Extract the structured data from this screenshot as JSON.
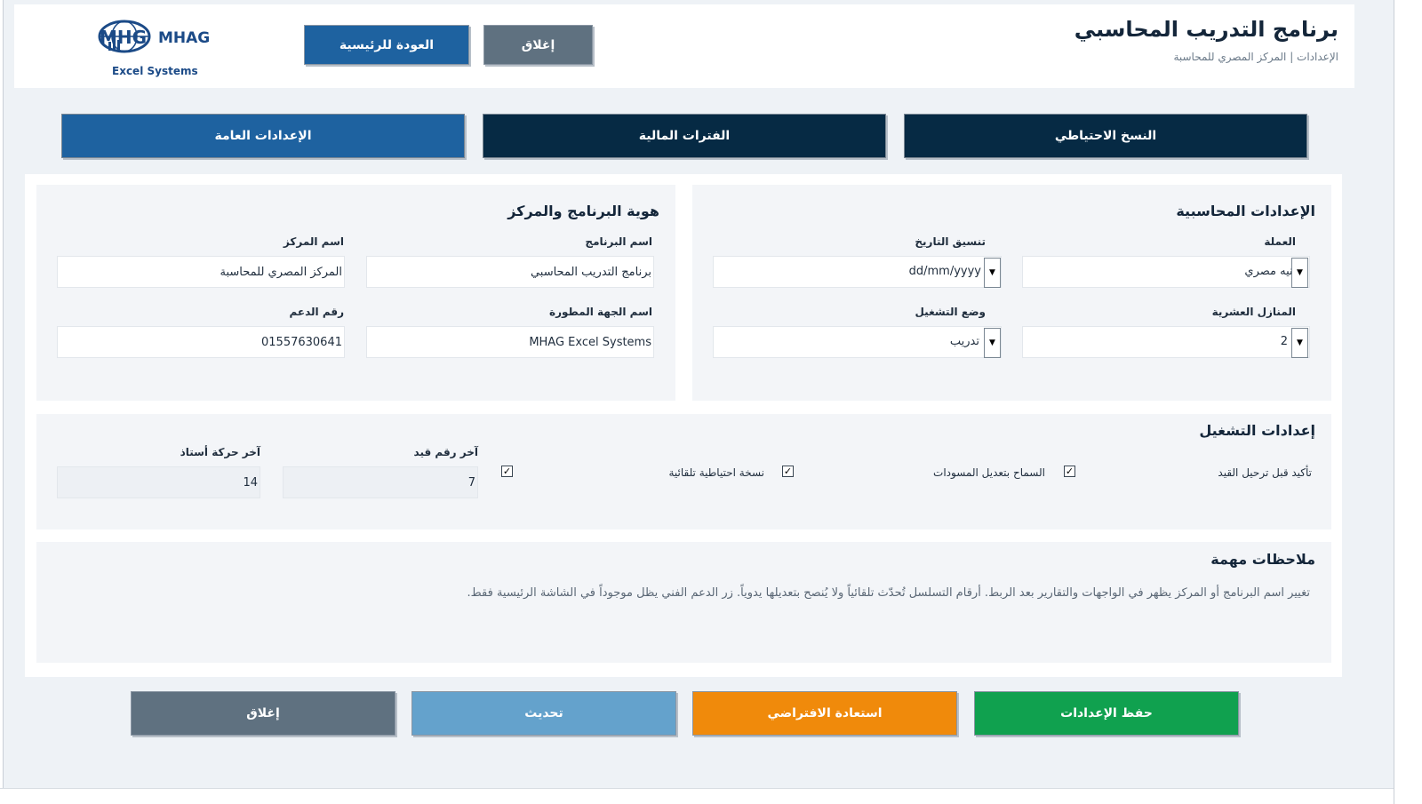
{
  "header": {
    "title": "برنامج التدريب المحاسبي",
    "subtitle": "الإعدادات | المركز المصري للمحاسبة",
    "logo_text": "MHAG",
    "logo_sub": "Excel Systems",
    "home_button": "العودة للرئيسية",
    "close_button": "إغلاق"
  },
  "tabs": [
    {
      "label": "النسخ الاحتياطي"
    },
    {
      "label": "الفترات المالية"
    },
    {
      "label": "الإعدادات العامة"
    }
  ],
  "accounting": {
    "title": "الإعدادات المحاسبية",
    "currency_label": "العملة",
    "currency_value": "جنيه مصري",
    "date_format_label": "تنسيق التاريخ",
    "date_format_value": "dd/mm/yyyy",
    "decimals_label": "المنازل العشرية",
    "decimals_value": "2",
    "mode_label": "وضع التشغيل",
    "mode_value": "تدريب"
  },
  "identity": {
    "title": "هوية البرنامج والمركز",
    "program_name_label": "اسم البرنامج",
    "program_name_value": "برنامج التدريب المحاسبي",
    "center_name_label": "اسم المركز",
    "center_name_value": "المركز المصري للمحاسبة",
    "developer_label": "اسم الجهة المطورة",
    "developer_value": "MHAG Excel Systems",
    "support_label": "رقم الدعم",
    "support_value": "01557630641"
  },
  "operation": {
    "title": "إعدادات التشغيل",
    "confirm_posting_label": "تأكيد قبل ترحيل القيد",
    "confirm_posting_checked": true,
    "allow_edit_drafts_label": "السماح بتعديل المسودات",
    "allow_edit_drafts_checked": true,
    "auto_backup_label": "نسخة احتياطية تلقائية",
    "auto_backup_checked": true,
    "last_entry_label": "آخر رقم قيد",
    "last_entry_value": "7",
    "last_voucher_label": "آخر حركة أستاذ",
    "last_voucher_value": "14"
  },
  "notes": {
    "title": "ملاحظات مهمة",
    "text": "تغيير اسم البرنامج أو المركز يظهر في الواجهات والتقارير بعد الربط. أرقام التسلسل تُحدّث تلقائياً ولا يُنصح بتعديلها يدوياً. زر الدعم الفني يظل موجوداً في الشاشة الرئيسية فقط."
  },
  "actions": {
    "save": "حفظ الإعدادات",
    "restore": "استعادة الافتراضي",
    "refresh": "تحديث",
    "close": "إغلاق"
  },
  "colors": {
    "primary": "#1e62a0",
    "dark_tab": "#062a44",
    "save": "#10a14f",
    "restore": "#f08a0b",
    "refresh": "#64a2cc",
    "close": "#5f7180"
  }
}
